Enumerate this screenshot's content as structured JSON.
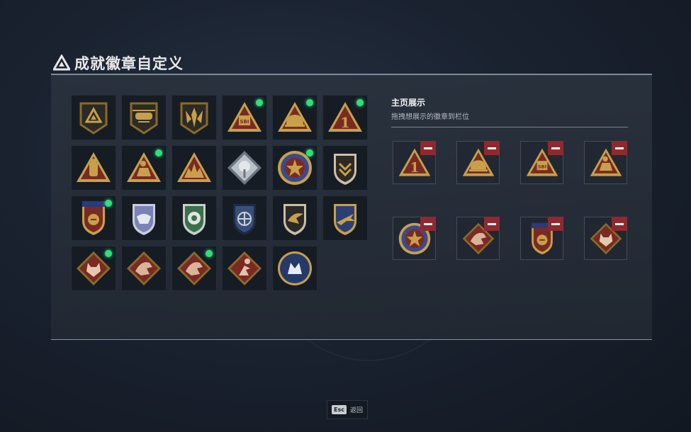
{
  "title": "成就徽章自定义",
  "showcase": {
    "title": "主页展示",
    "subtitle": "拖拽想展示的徽章到栏位",
    "slots": [
      {
        "badge": "triangle-1"
      },
      {
        "badge": "triangle-helmet"
      },
      {
        "badge": "triangle-sbi"
      },
      {
        "badge": "triangle-runner"
      },
      {
        "badge": "round-star"
      },
      {
        "badge": "diamond-dragon"
      },
      {
        "badge": "shield-blue-star"
      },
      {
        "badge": "diamond-wolf"
      }
    ]
  },
  "badges": [
    {
      "type": "square-triangle",
      "new": false
    },
    {
      "type": "square-helicopter",
      "new": false
    },
    {
      "type": "square-wings",
      "new": false
    },
    {
      "type": "triangle-sbi",
      "new": true
    },
    {
      "type": "triangle-helmet",
      "new": true
    },
    {
      "type": "triangle-1",
      "new": true
    },
    {
      "type": "triangle-figure",
      "new": false
    },
    {
      "type": "triangle-runner",
      "new": true
    },
    {
      "type": "triangle-ruin",
      "new": false
    },
    {
      "type": "diamond-silver",
      "new": false
    },
    {
      "type": "round-star",
      "new": true
    },
    {
      "type": "shield-chevron",
      "new": false
    },
    {
      "type": "shield-blue-star",
      "new": true
    },
    {
      "type": "shield-silver-wing",
      "new": false
    },
    {
      "type": "shield-green-flower",
      "new": false
    },
    {
      "type": "shield-blue-crosshair",
      "new": false
    },
    {
      "type": "shield-dark-hawk",
      "new": false
    },
    {
      "type": "shield-blue-plane",
      "new": false
    },
    {
      "type": "diamond-wolf",
      "new": true
    },
    {
      "type": "diamond-dragon",
      "new": false
    },
    {
      "type": "diamond-dragon",
      "new": true
    },
    {
      "type": "diamond-runner",
      "new": false
    },
    {
      "type": "round-blue-wolf",
      "new": false
    }
  ],
  "footer": {
    "key": "Esc",
    "label": "返回"
  },
  "colors": {
    "accent_gold": "#c8a04a",
    "dark_red": "#7a2a22",
    "new_indicator": "#2de07a",
    "remove": "#8e2a2e"
  }
}
